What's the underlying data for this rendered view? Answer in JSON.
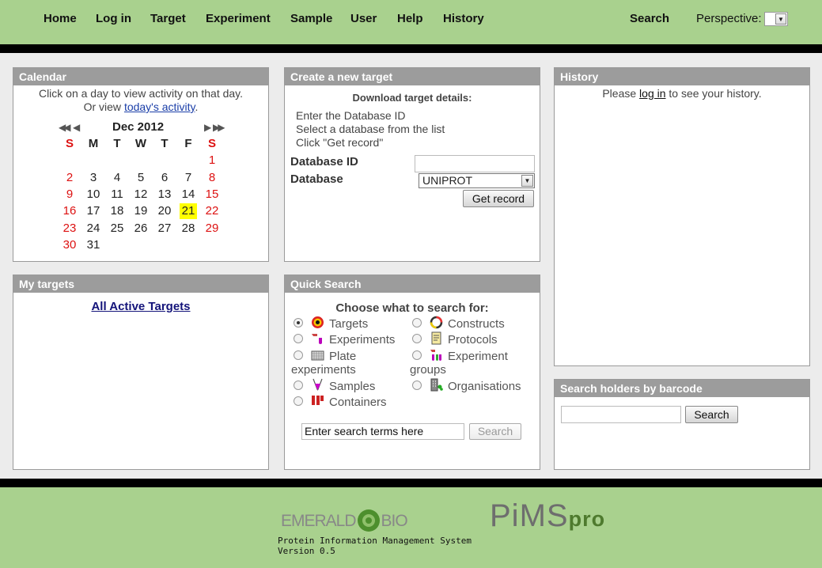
{
  "nav": {
    "items": [
      "Home",
      "Log in",
      "Target",
      "Experiment",
      "Sample",
      "User",
      "Help",
      "History"
    ],
    "search": "Search",
    "perspective_label": "Perspective:"
  },
  "calendar": {
    "title": "Calendar",
    "intro_line1": "Click on a day to view activity on that day.",
    "intro_line2_prefix": "Or view",
    "intro_link": "today's activity",
    "intro_suffix": ".",
    "prev_year": "◀◀",
    "prev_month": "◀",
    "next_month": "▶",
    "next_year": "▶▶",
    "month_label": "Dec 2012",
    "weekdays": [
      "S",
      "M",
      "T",
      "W",
      "T",
      "F",
      "S"
    ],
    "weeks": [
      [
        "",
        "",
        "",
        "",
        "",
        "",
        "1"
      ],
      [
        "2",
        "3",
        "4",
        "5",
        "6",
        "7",
        "8"
      ],
      [
        "9",
        "10",
        "11",
        "12",
        "13",
        "14",
        "15"
      ],
      [
        "16",
        "17",
        "18",
        "19",
        "20",
        "21",
        "22"
      ],
      [
        "23",
        "24",
        "25",
        "26",
        "27",
        "28",
        "29"
      ],
      [
        "30",
        "31",
        "",
        "",
        "",
        "",
        ""
      ]
    ],
    "today": "21"
  },
  "create_target": {
    "title": "Create a new target",
    "heading": "Download target details:",
    "instructions": [
      "Enter the Database ID",
      "Select a database from the list",
      "Click \"Get record\""
    ],
    "db_id_label": "Database ID",
    "db_id_value": "",
    "database_label": "Database",
    "database_selected": "UNIPROT",
    "button": "Get record"
  },
  "history": {
    "title": "History",
    "text_prefix": "Please",
    "link": "log in",
    "text_suffix": "to see your history."
  },
  "my_targets": {
    "title": "My targets",
    "link": "All Active Targets"
  },
  "quick_search": {
    "title": "Quick Search",
    "heading": "Choose what to search for:",
    "options": {
      "targets": "Targets",
      "constructs": "Constructs",
      "experiments": "Experiments",
      "protocols": "Protocols",
      "plate_line1": "Plate",
      "plate_line2": "experiments",
      "expgroups_line1": "Experiment",
      "expgroups_line2": "groups",
      "samples": "Samples",
      "organisations": "Organisations",
      "containers": "Containers"
    },
    "input_value": "Enter search terms here",
    "button": "Search"
  },
  "barcode": {
    "title": "Search holders by barcode",
    "input_value": "",
    "button": "Search"
  },
  "footer": {
    "emerald_left": "EMERALD",
    "emerald_right": "BIO",
    "pims": "PiMS",
    "pims_pro": "pro",
    "system_name": "Protein Information Management System",
    "version": "Version 0.5"
  },
  "colors": {
    "header_green": "#a9d18e",
    "panel_title_gray": "#9c9c9c",
    "weekend_red": "#d11111",
    "today_highlight": "#ffff00"
  }
}
